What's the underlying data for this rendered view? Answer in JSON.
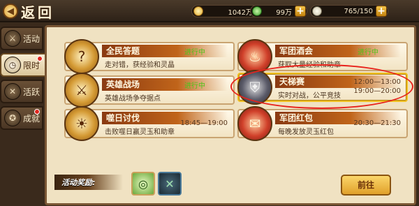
{
  "header": {
    "back_label": "返回",
    "resources": [
      {
        "icon": "coin-icon",
        "value": "1042万"
      },
      {
        "icon": "jade-icon",
        "value": "99万"
      },
      {
        "icon": "bowl-icon",
        "value": "765/150"
      }
    ]
  },
  "sidebar": {
    "items": [
      {
        "label": "活动",
        "icon": "⚔",
        "active": false,
        "dot": false
      },
      {
        "label": "限时",
        "icon": "◷",
        "active": true,
        "dot": true
      },
      {
        "label": "活跃",
        "icon": "✕",
        "active": false,
        "dot": false
      },
      {
        "label": "成就",
        "icon": "✪",
        "active": false,
        "dot": true
      }
    ]
  },
  "events": [
    {
      "title": "全民答题",
      "status": "进行中",
      "desc": "走对错，获经验和灵晶",
      "time": ""
    },
    {
      "title": "军团酒会",
      "status": "进行中",
      "desc": "获取大量经验和助章",
      "time": ""
    },
    {
      "title": "英雄战场",
      "status": "进行中",
      "desc": "英雄战场争夺据点",
      "time": ""
    },
    {
      "title": "天梯赛",
      "status": "",
      "desc": "实时对战，公平竞技",
      "time": "12:00—13:00",
      "time_b": "19:00—20:00"
    },
    {
      "title": "噬日讨伐",
      "status": "",
      "desc": "击败噬日赢灵玉和助章",
      "time": "18:45—19:00"
    },
    {
      "title": "军团红包",
      "status": "",
      "desc": "每晚发放灵玉红包",
      "time": "20:30—21:30"
    }
  ],
  "reward": {
    "label": "活动奖励:"
  },
  "go_button": "前往",
  "colors": {
    "status_green": "#4ec41a",
    "highlight_ring": "#e8221c",
    "accent_gold": "#f0c020"
  }
}
